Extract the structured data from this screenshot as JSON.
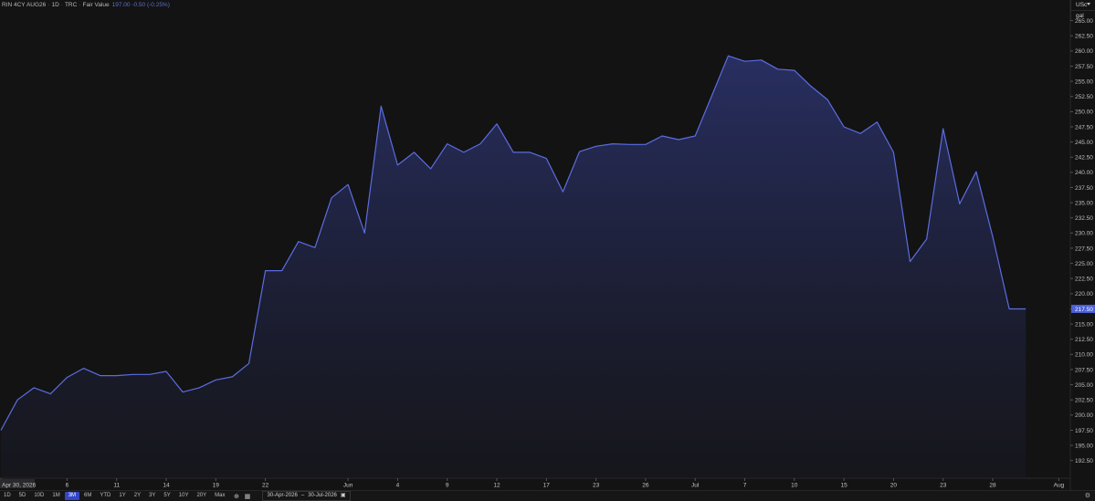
{
  "header": {
    "symbol": "RIN 4CY AUG26",
    "interval": "1D",
    "source": "TRC",
    "field": "Fair Value",
    "quote": "197.00 -0.50 (-0.25%)"
  },
  "units": {
    "currency": "USc",
    "measure": "gal"
  },
  "toolbar": {
    "timeframes": [
      "1D",
      "5D",
      "10D",
      "1M",
      "3M",
      "6M",
      "YTD",
      "1Y",
      "2Y",
      "3Y",
      "5Y",
      "10Y",
      "20Y",
      "Max"
    ],
    "active": "3M",
    "date_from": "30-Apr-2026",
    "date_sep": "–",
    "date_to": "30-Jul-2026"
  },
  "colors": {
    "line": "#5b6de0",
    "background": "#131314",
    "price_label": "#4b5fd6"
  },
  "chart_data": {
    "type": "area",
    "title": "",
    "xlabel": "",
    "ylabel": "",
    "ylim": [
      190.5,
      267.5
    ],
    "y_ticks": [
      192.5,
      195,
      197.5,
      200,
      202.5,
      205,
      207.5,
      210,
      212.5,
      215,
      217.5,
      220,
      222.5,
      225,
      227.5,
      230,
      232.5,
      235,
      237.5,
      240,
      242.5,
      245,
      247.5,
      250,
      252.5,
      255,
      257.5,
      260,
      262.5,
      265
    ],
    "x_tick_labels": [
      {
        "label": "Apr 30, 2026",
        "x": 0
      },
      {
        "label": "6",
        "x": 4
      },
      {
        "label": "11",
        "x": 7
      },
      {
        "label": "14",
        "x": 10
      },
      {
        "label": "19",
        "x": 13
      },
      {
        "label": "22",
        "x": 16
      },
      {
        "label": "Jun",
        "x": 21
      },
      {
        "label": "4",
        "x": 24
      },
      {
        "label": "9",
        "x": 27
      },
      {
        "label": "12",
        "x": 30
      },
      {
        "label": "17",
        "x": 33
      },
      {
        "label": "23",
        "x": 36
      },
      {
        "label": "26",
        "x": 39
      },
      {
        "label": "Jul",
        "x": 42
      },
      {
        "label": "7",
        "x": 45
      },
      {
        "label": "10",
        "x": 48
      },
      {
        "label": "15",
        "x": 51
      },
      {
        "label": "20",
        "x": 54
      },
      {
        "label": "23",
        "x": 57
      },
      {
        "label": "28",
        "x": 60
      },
      {
        "label": "Aug",
        "x": 64
      }
    ],
    "values": [
      197.5,
      202.5,
      204.5,
      203.5,
      206.2,
      207.7,
      206.5,
      206.5,
      206.7,
      206.7,
      207.2,
      203.8,
      204.5,
      205.8,
      206.3,
      208.5,
      223.8,
      223.8,
      228.6,
      227.6,
      235.8,
      238.0,
      230.0,
      250.9,
      241.2,
      243.3,
      240.6,
      244.7,
      243.3,
      244.7,
      248.0,
      243.3,
      243.3,
      242.3,
      236.8,
      243.4,
      244.3,
      244.7,
      244.6,
      244.6,
      246.0,
      245.4,
      246.0,
      252.6,
      259.2,
      258.3,
      258.5,
      257.0,
      256.8,
      254.2,
      252.0,
      247.5,
      246.4,
      248.3,
      243.3,
      225.3,
      229.0,
      247.2,
      234.8,
      240.1,
      229.4,
      217.5,
      217.5
    ],
    "last_value": 217.5,
    "last_value_label": "217.50",
    "grid": false,
    "legend": "none"
  }
}
